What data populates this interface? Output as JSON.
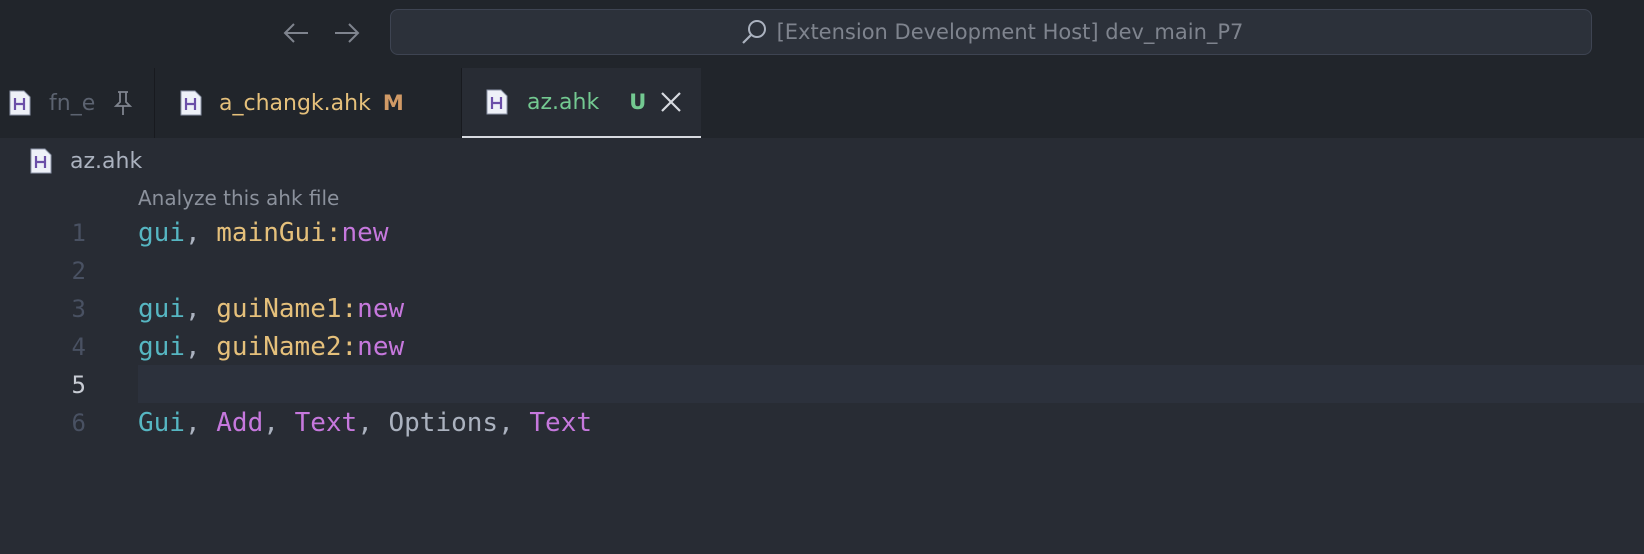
{
  "window": {
    "search_text": "[Extension Development Host] dev_main_P7"
  },
  "tabs": [
    {
      "label": "fn_e",
      "status": ""
    },
    {
      "label": "a_changk.ahk",
      "status": "M"
    },
    {
      "label": "az.ahk",
      "status": "U"
    }
  ],
  "breadcrumb": {
    "file": "az.ahk"
  },
  "codelens": "Analyze this ahk file",
  "editor": {
    "current_line": 5,
    "lines": [
      {
        "number": "1",
        "tokens": [
          {
            "t": "gui",
            "k": "cmd"
          },
          {
            "t": ", ",
            "k": "punc"
          },
          {
            "t": "mainGui",
            "k": "name"
          },
          {
            "t": ":",
            "k": "name"
          },
          {
            "t": "new",
            "k": "kw"
          }
        ]
      },
      {
        "number": "2",
        "tokens": []
      },
      {
        "number": "3",
        "tokens": [
          {
            "t": "gui",
            "k": "cmd"
          },
          {
            "t": ", ",
            "k": "punc"
          },
          {
            "t": "guiName1",
            "k": "name"
          },
          {
            "t": ":",
            "k": "name"
          },
          {
            "t": "new",
            "k": "kw"
          }
        ]
      },
      {
        "number": "4",
        "tokens": [
          {
            "t": "gui",
            "k": "cmd"
          },
          {
            "t": ", ",
            "k": "punc"
          },
          {
            "t": "guiName2",
            "k": "name"
          },
          {
            "t": ":",
            "k": "name"
          },
          {
            "t": "new",
            "k": "kw"
          }
        ]
      },
      {
        "number": "5",
        "tokens": []
      },
      {
        "number": "6",
        "tokens": [
          {
            "t": "Gui",
            "k": "cmd"
          },
          {
            "t": ", ",
            "k": "punc"
          },
          {
            "t": "Add",
            "k": "kw"
          },
          {
            "t": ", ",
            "k": "punc"
          },
          {
            "t": "Text",
            "k": "kw"
          },
          {
            "t": ", ",
            "k": "punc"
          },
          {
            "t": "Options",
            "k": "plain"
          },
          {
            "t": ", ",
            "k": "punc"
          },
          {
            "t": "Text",
            "k": "kw"
          }
        ]
      }
    ]
  },
  "colors": {
    "background": "#282c34",
    "titlebar": "#21252b",
    "modified": "#e5c07b",
    "untracked": "#73c991",
    "keyword": "#c678dd",
    "command": "#56b6c2"
  }
}
